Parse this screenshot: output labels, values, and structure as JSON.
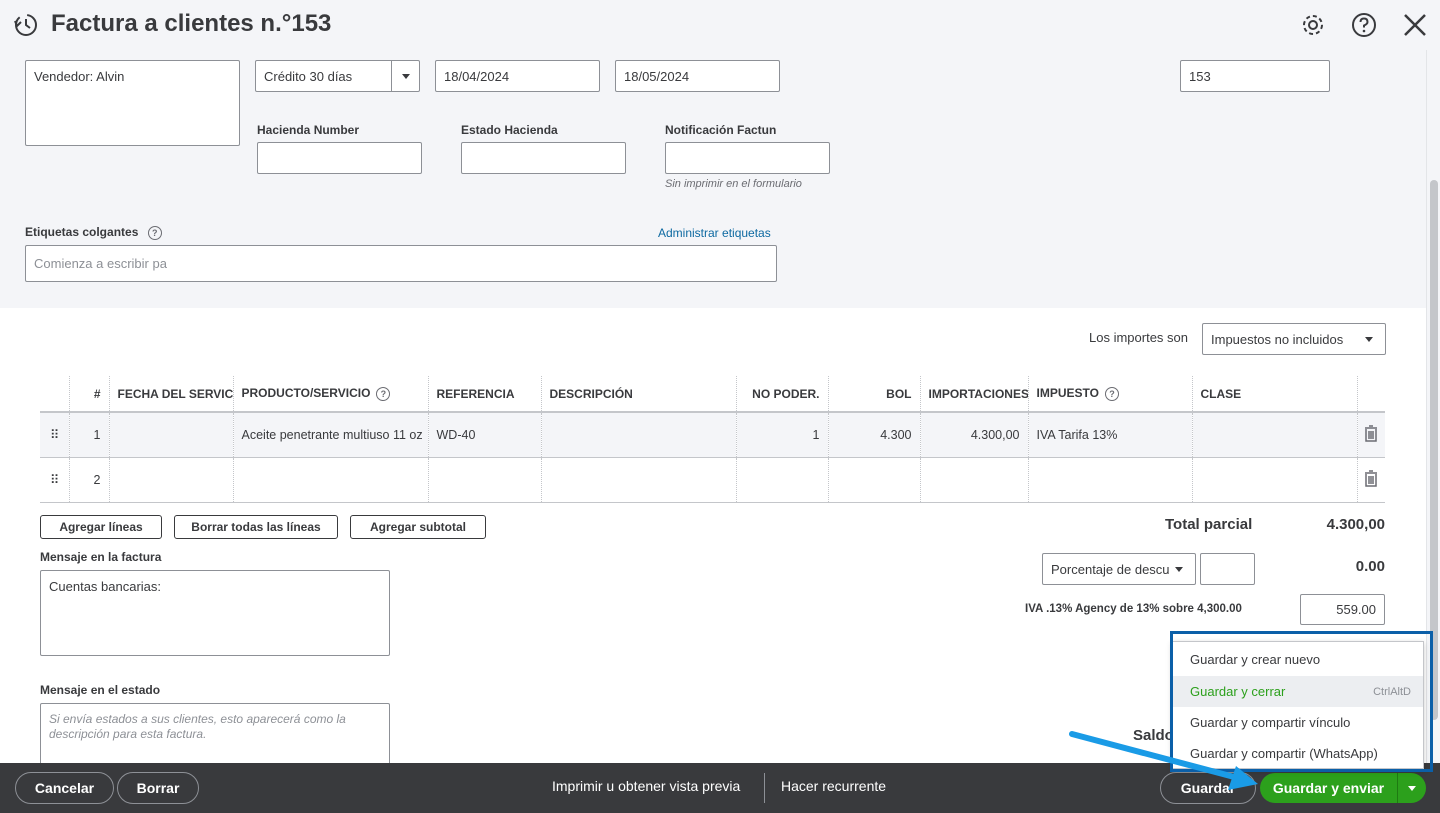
{
  "header": {
    "title": "Factura a clientes n.°153",
    "icons": [
      "history-icon",
      "settings-icon",
      "help-icon",
      "close-icon"
    ]
  },
  "form": {
    "address_value": "Vendedor: Alvin",
    "terms_value": "Crédito 30 días",
    "invoice_date": "18/04/2024",
    "due_date": "18/05/2024",
    "invoice_number": "153",
    "hacienda_number_label": "Hacienda Number",
    "hacienda_number_value": "",
    "estado_hacienda_label": "Estado Hacienda",
    "estado_hacienda_value": "",
    "notificacion_label": "Notificación Factun",
    "notificacion_value": "",
    "notificacion_note": "Sin imprimir en el formulario",
    "tags_label": "Etiquetas colgantes",
    "manage_tags_link": "Administrar etiquetas",
    "tags_placeholder": "Comienza a escribir pa"
  },
  "amounts": {
    "label": "Los importes son",
    "value": "Impuestos no incluidos"
  },
  "table": {
    "headers": {
      "num": "#",
      "fecha": "FECHA DEL SERVICIO",
      "producto": "PRODUCTO/SERVICIO",
      "referencia": "REFERENCIA",
      "descripcion": "DESCRIPCIÓN",
      "no_poder": "NO PODER.",
      "bol": "BOL",
      "importaciones": "IMPORTACIONES",
      "impuesto": "IMPUESTO",
      "clase": "CLASE"
    },
    "rows": [
      {
        "num": "1",
        "fecha": "",
        "producto": "Aceite penetrante multiuso 11 oz",
        "referencia": "WD-40",
        "descripcion": "",
        "no_poder": "1",
        "bol": "4.300",
        "importaciones": "4.300,00",
        "impuesto": "IVA Tarifa 13%",
        "clase": ""
      },
      {
        "num": "2",
        "fecha": "",
        "producto": "",
        "referencia": "",
        "descripcion": "",
        "no_poder": "",
        "bol": "",
        "importaciones": "",
        "impuesto": "",
        "clase": ""
      }
    ]
  },
  "line_buttons": {
    "add": "Agregar líneas",
    "clear": "Borrar todas las líneas",
    "subtotal": "Agregar subtotal"
  },
  "messages": {
    "invoice_label": "Mensaje en la factura",
    "invoice_value": "Cuentas bancarias:",
    "statement_label": "Mensaje en el estado",
    "statement_placeholder": "Si envía estados a sus clientes, esto aparecerá como la descripción para esta factura."
  },
  "totals": {
    "subtotal_label": "Total parcial",
    "subtotal_value": "4.300,00",
    "discount_select": "Porcentaje de descuento",
    "discount_input": "",
    "discount_value": "0.00",
    "tax_label": "IVA .13% Agency de 13% sobre 4,300.00",
    "tax_value": "559.00",
    "balance_label": "Saldo"
  },
  "dropdown": {
    "items": [
      {
        "label": "Guardar y crear nuevo",
        "shortcut": ""
      },
      {
        "label": "Guardar y cerrar",
        "shortcut": "CtrlAltD"
      },
      {
        "label": "Guardar y compartir vínculo",
        "shortcut": ""
      },
      {
        "label": "Guardar y compartir (WhatsApp)",
        "shortcut": ""
      }
    ]
  },
  "footer": {
    "cancel": "Cancelar",
    "clear": "Borrar",
    "print": "Imprimir u obtener vista previa",
    "recurring": "Hacer recurrente",
    "save": "Guardar",
    "save_send": "Guardar y enviar"
  },
  "colors": {
    "accent_green": "#2ca01c",
    "link_blue": "#0d69a1",
    "highlight_blue": "#0b5fa8",
    "arrow_blue": "#1a9be6",
    "footer_bg": "#393a3d"
  }
}
